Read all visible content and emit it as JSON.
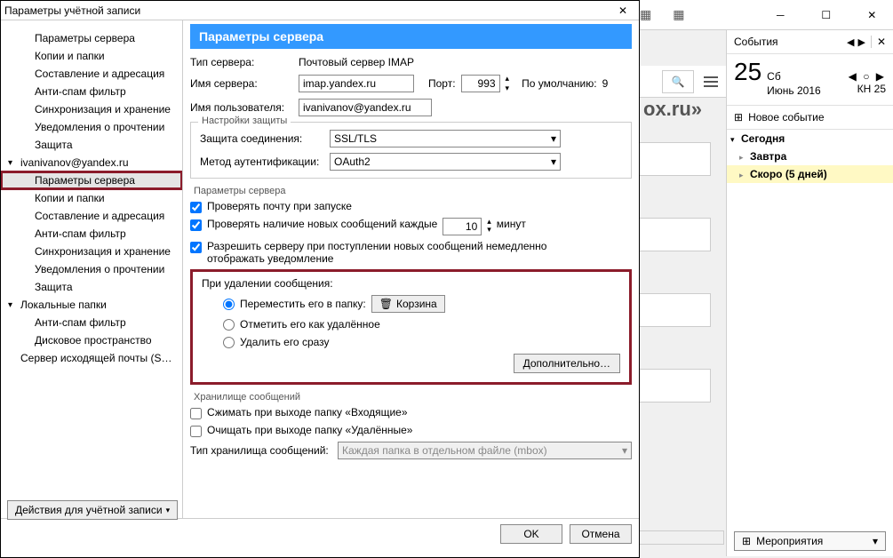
{
  "dialog": {
    "title": "Параметры учётной записи",
    "sidebar": {
      "top_section": [
        "Параметры сервера",
        "Копии и папки",
        "Составление и адресация",
        "Анти-спам фильтр",
        "Синхронизация и хранение",
        "Уведомления о прочтении",
        "Защита"
      ],
      "account_label": "ivanivanov@yandex.ru",
      "account_items": [
        "Параметры сервера",
        "Копии и папки",
        "Составление и адресация",
        "Анти-спам фильтр",
        "Синхронизация и хранение",
        "Уведомления о прочтении",
        "Защита"
      ],
      "local_label": "Локальные папки",
      "local_items": [
        "Анти-спам фильтр",
        "Дисковое пространство"
      ],
      "outgoing": "Сервер исходящей почты (S…"
    },
    "actions_btn": "Действия для учётной записи",
    "header": "Параметры сервера",
    "server_type_label": "Тип сервера:",
    "server_type_value": "Почтовый сервер IMAP",
    "server_name_label": "Имя сервера:",
    "server_name_value": "imap.yandex.ru",
    "port_label": "Порт:",
    "port_value": "993",
    "port_default_label": "По умолчанию:",
    "port_default_value": "9",
    "username_label": "Имя пользователя:",
    "username_value": "ivanivanov@yandex.ru",
    "security_group": "Настройки защиты",
    "conn_sec_label": "Защита соединения:",
    "conn_sec_value": "SSL/TLS",
    "auth_label": "Метод аутентификации:",
    "auth_value": "OAuth2",
    "server_params_group": "Параметры сервера",
    "chk_startup": "Проверять почту при запуске",
    "chk_interval_a": "Проверять наличие новых сообщений каждые",
    "interval_value": "10",
    "chk_interval_b": "минут",
    "chk_push_a": "Разрешить серверу при поступлении новых сообщений немедленно",
    "chk_push_b": "отображать уведомление",
    "delete_title": "При удалении сообщения:",
    "radio_move": "Переместить его в папку:",
    "trash_btn": "Корзина",
    "radio_mark": "Отметить его как удалённое",
    "radio_del": "Удалить его сразу",
    "advanced_btn": "Дополнительно…",
    "storage_group": "Хранилище сообщений",
    "chk_compact": "Сжимать при выходе папку «Входящие»",
    "chk_empty": "Очищать при выходе папку «Удалённые»",
    "storage_type_label": "Тип хранилища сообщений:",
    "storage_type_value": "Каждая папка в отдельном файле (mbox)",
    "ok_btn": "OK",
    "cancel_btn": "Отмена"
  },
  "calendar": {
    "title": "События",
    "day_num": "25",
    "day_name": "Сб",
    "month": "Июнь 2016",
    "week": "КН 25",
    "new_event": "Новое событие",
    "today": "Сегодня",
    "tomorrow": "Завтра",
    "soon": "Скоро (5 дней)",
    "bottom_btn": "Мероприятия"
  },
  "bg_fragment": "ox.ru»"
}
